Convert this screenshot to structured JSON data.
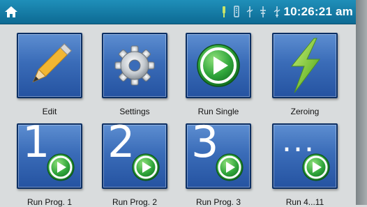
{
  "status_bar": {
    "time": "10:26:21 am",
    "icons": [
      "home-icon",
      "probe-icon",
      "usb-icon",
      "usb-icon",
      "usb-icon",
      "usb-icon"
    ]
  },
  "tiles": [
    {
      "label": "Edit",
      "icon": "pencil-icon"
    },
    {
      "label": "Settings",
      "icon": "gear-icon"
    },
    {
      "label": "Run Single",
      "icon": "play-icon"
    },
    {
      "label": "Zeroing",
      "icon": "lightning-icon"
    },
    {
      "label": "Run Prog. 1",
      "number": "1",
      "icon": "play-icon"
    },
    {
      "label": "Run Prog. 2",
      "number": "2",
      "icon": "play-icon"
    },
    {
      "label": "Run Prog. 3",
      "number": "3",
      "icon": "play-icon"
    },
    {
      "label": "Run 4...11",
      "number": "...",
      "icon": "play-icon"
    }
  ],
  "colors": {
    "status_bar": "#157fa9",
    "tile_blue": "#3a6cb8",
    "play_green": "#2fa53a",
    "lightning_green": "#7cc23a"
  }
}
